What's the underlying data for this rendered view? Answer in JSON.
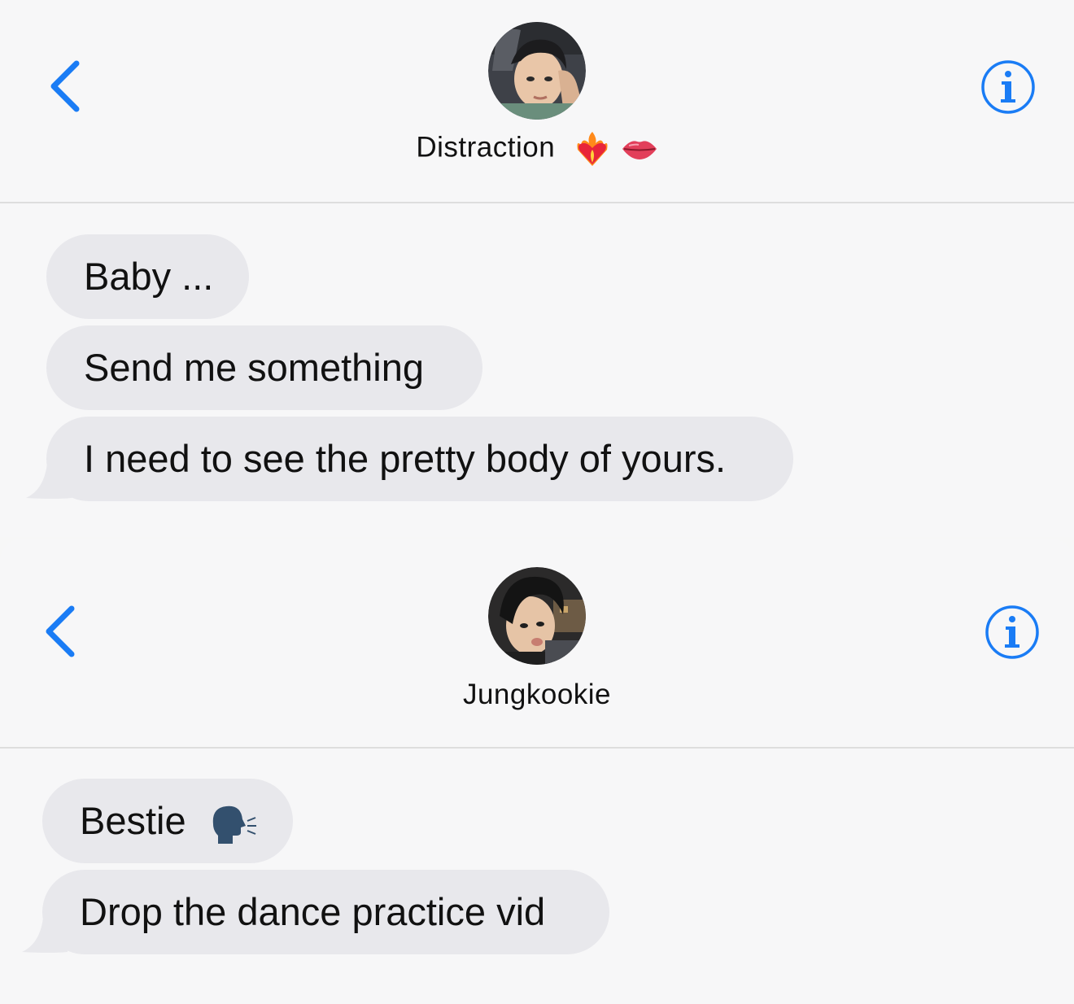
{
  "accent": "#1a7cf5",
  "bubble_color": "#e8e8ec",
  "conversations": [
    {
      "contact_name": "Distraction",
      "name_emojis": [
        "heart-on-fire",
        "lips"
      ],
      "messages": [
        "Baby ...",
        "Send me something",
        "I need to see the pretty body of yours."
      ]
    },
    {
      "contact_name": "Jungkookie",
      "name_emojis": [],
      "messages": [
        "Bestie",
        "Drop the dance practice vid"
      ],
      "message_emojis": [
        "speaking-head"
      ]
    }
  ],
  "icons": [
    "chevron-left-icon",
    "info-icon",
    "avatar",
    "heart-on-fire-icon",
    "lips-icon",
    "speaking-head-icon"
  ]
}
